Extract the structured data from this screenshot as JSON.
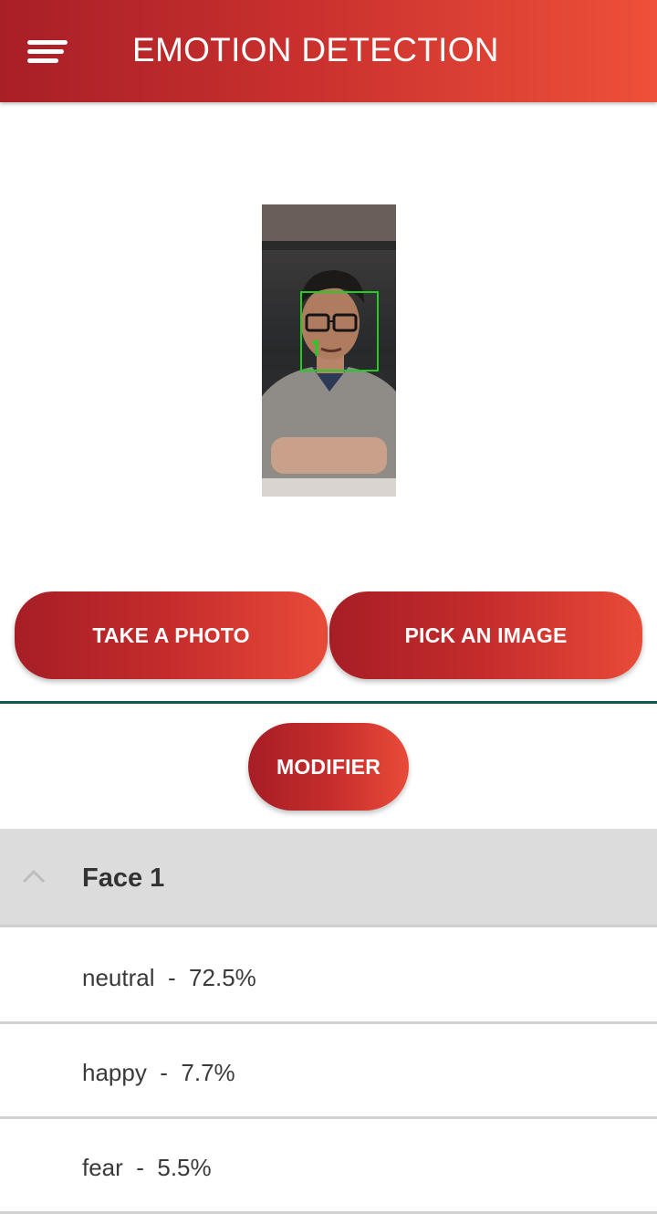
{
  "app_bar": {
    "title": "EMOTION DETECTION",
    "menu_icon": "menu-icon",
    "color_start": "#a81f26",
    "color_end": "#ee5039"
  },
  "photo": {
    "face_box_color": "#22cc22"
  },
  "buttons": {
    "take_photo": "TAKE A PHOTO",
    "pick_image": "PICK AN IMAGE",
    "modifier": "MODIFIER"
  },
  "results": {
    "face_label": "Face 1",
    "expand_icon": "chevron-up-icon",
    "emotions": [
      {
        "text": "neutral  -  72.5%"
      },
      {
        "text": "happy  -  7.7%"
      },
      {
        "text": "fear  -  5.5%"
      }
    ]
  }
}
